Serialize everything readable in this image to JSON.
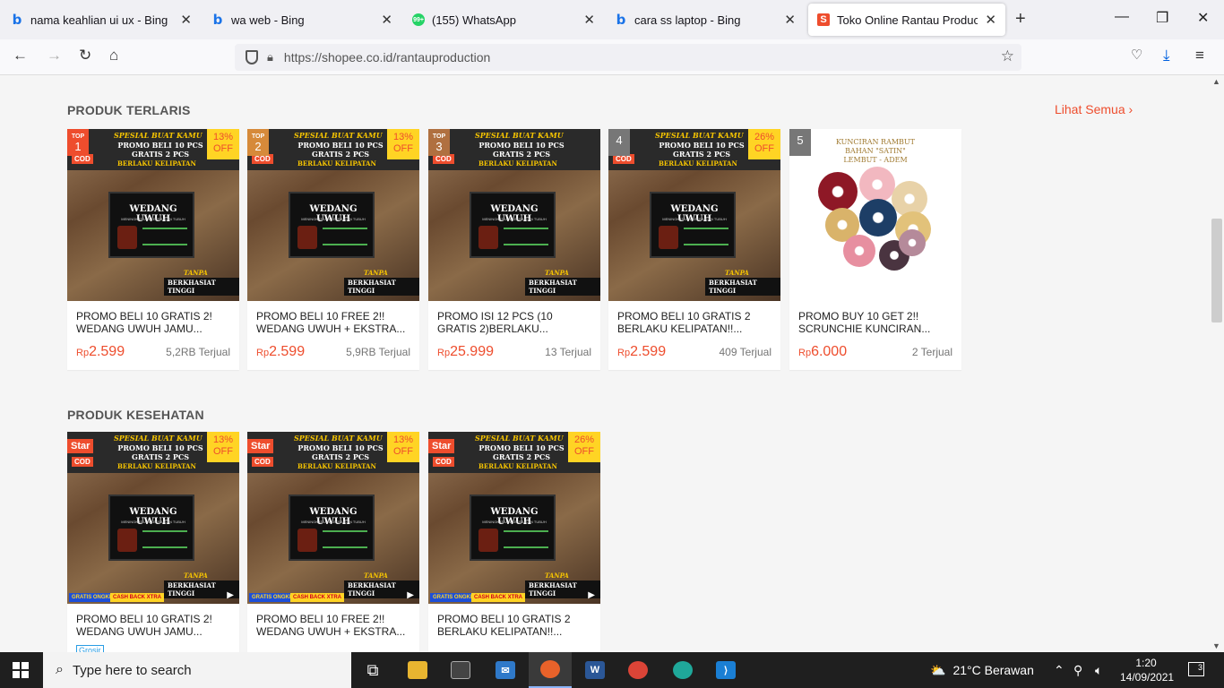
{
  "browser": {
    "tabs": [
      {
        "title": "nama keahlian ui ux - Bing",
        "icon": "bing-icon"
      },
      {
        "title": "wa web - Bing",
        "icon": "bing-icon"
      },
      {
        "title": "(155) WhatsApp",
        "icon": "whatsapp-icon",
        "badge": "99+"
      },
      {
        "title": "cara ss laptop - Bing",
        "icon": "bing-icon"
      },
      {
        "title": "Toko Online Rantau Production",
        "icon": "shopee-icon",
        "active": true
      }
    ],
    "url": "https://shopee.co.id/rantauproduction"
  },
  "sections": {
    "bestseller": {
      "title": "PRODUK TERLARIS",
      "see_all": "Lihat Semua",
      "items": [
        {
          "rank": "1",
          "rank_label": "TOP",
          "discount": "13%",
          "off": "OFF",
          "name": "PROMO BELI 10 GRATIS 2! WEDANG UWUH JAMU...",
          "currency": "Rp",
          "price": "2.599",
          "sold": "5,2RB Terjual"
        },
        {
          "rank": "2",
          "rank_label": "TOP",
          "discount": "13%",
          "off": "OFF",
          "name": "PROMO BELI 10 FREE 2!! WEDANG UWUH + EKSTRA...",
          "currency": "Rp",
          "price": "2.599",
          "sold": "5,9RB Terjual"
        },
        {
          "rank": "3",
          "rank_label": "TOP",
          "discount": "",
          "off": "",
          "name": "PROMO ISI 12 PCS (10 GRATIS 2)BERLAKU...",
          "currency": "Rp",
          "price": "25.999",
          "sold": "13 Terjual"
        },
        {
          "rank": "4",
          "rank_label": "",
          "discount": "26%",
          "off": "OFF",
          "name": "PROMO BELI 10 GRATIS 2 BERLAKU KELIPATAN!!...",
          "currency": "Rp",
          "price": "2.599",
          "sold": "409 Terjual"
        },
        {
          "rank": "5",
          "rank_label": "",
          "discount": "",
          "off": "",
          "name": "PROMO BUY 10 GET 2!! SCRUNCHIE KUNCIRAN...",
          "currency": "Rp",
          "price": "6.000",
          "sold": "2 Terjual"
        }
      ]
    },
    "health": {
      "title": "PRODUK KESEHATAN",
      "items": [
        {
          "badge": "Star",
          "discount": "13%",
          "off": "OFF",
          "name": "PROMO BELI 10 GRATIS 2! WEDANG UWUH JAMU...",
          "tag": "Grosir"
        },
        {
          "badge": "Star",
          "discount": "13%",
          "off": "OFF",
          "name": "PROMO BELI 10 FREE 2!! WEDANG UWUH + EKSTRA..."
        },
        {
          "badge": "Star",
          "discount": "26%",
          "off": "OFF",
          "name": "PROMO BELI 10 GRATIS 2 BERLAKU KELIPATAN!!..."
        }
      ]
    }
  },
  "product_image": {
    "headline": "SPESIAL BUAT KAMU",
    "line1": "PROMO BELI 10 PCS",
    "line2": "GRATIS 2 PCS",
    "line3": "BERLAKU KELIPATAN",
    "cod": "COD",
    "board_title": "WEDANG UWUH",
    "board_sub": "MENINGKATKAN KEKEBALAN TUBUH",
    "tag1": "TANPA GEPREK",
    "tag2": "BERKHASIAT TINGGI",
    "promo1": "GRATIS ONGKIR XTRA",
    "promo2": "CASH BACK XTRA"
  },
  "scrunchie_image": {
    "line1": "KUNCIRAN RAMBUT",
    "line2": "BAHAN \"SATIN\"",
    "line3": "LEMBUT - ADEM"
  },
  "taskbar": {
    "search_placeholder": "Type here to search",
    "weather": "21°C  Berawan",
    "time": "1:20",
    "date": "14/09/2021",
    "notifications": "3"
  },
  "colors": {
    "accent": "#ee4d2d",
    "discount_bg": "#ffd424"
  }
}
